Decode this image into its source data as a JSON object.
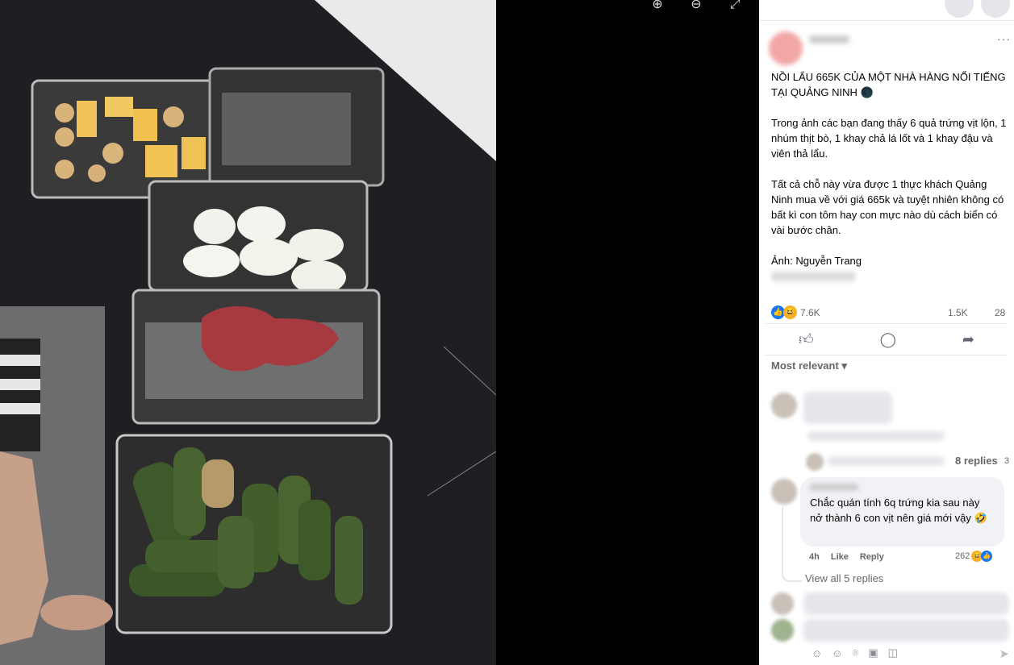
{
  "viewer": {
    "tools": [
      {
        "icon": "zoom-in-icon",
        "glyph": "⊕"
      },
      {
        "icon": "zoom-out-icon",
        "glyph": "⊖"
      },
      {
        "icon": "fullscreen-icon",
        "glyph": "⤢"
      }
    ]
  },
  "post": {
    "title": "NỒI LẨU 665K CỦA MỘT NHÀ HÀNG NỔI TIẾNG TẠI QUẢNG NINH 🌑",
    "paragraph1": "Trong ảnh các bạn đang thấy 6 quả trứng vịt lộn, 1 nhúm thịt bò, 1 khay chả lá lốt và 1 khay đậu và viên thả lẩu.",
    "paragraph2": "Tất cả chỗ này vừa được 1 thực khách Quảng Ninh mua về với giá 665k và tuyệt nhiên không có bất kì con tôm hay con mực nào dù cách biển có vài bước chân.",
    "credit": "Ảnh: Nguyễn Trang",
    "more": "···"
  },
  "stats": {
    "reactions": "7.6K",
    "comments": "1.5K",
    "shares": "28"
  },
  "sort_label": "Most relevant ▾",
  "comments": {
    "first_replies": "8 replies",
    "first_replies_tail": "3",
    "second_text": "Chắc quán tính 6q trứng kia sau này nở thành 6 con vịt nên giá mới vậy 🤣",
    "second_time": "4h",
    "second_like": "Like",
    "second_reply": "Reply",
    "second_reacts": "262",
    "view_all": "View all 5 replies"
  }
}
